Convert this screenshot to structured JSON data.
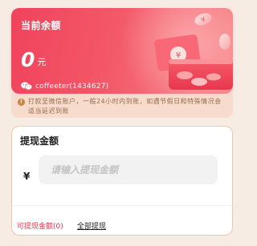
{
  "balance": {
    "label": "当前余额",
    "amount": "0",
    "unit": "元",
    "account": "coffeeter(1434627)",
    "account_icon": "wechat-icon"
  },
  "notice": {
    "icon": "info-icon",
    "text": "打款至微信账户，一般24小时内到账，如遇节假日和特殊情况会适当延迟到账"
  },
  "withdraw": {
    "title": "提现金额",
    "currency_symbol": "¥",
    "placeholder": "请输入提现金额",
    "value": "",
    "available_label": "可提现金额(0)",
    "withdraw_all_label": "全部提现"
  },
  "colors": {
    "accent": "#f0435c",
    "notice_bg": "#f7dccd",
    "page_bg": "#f6ece4"
  }
}
